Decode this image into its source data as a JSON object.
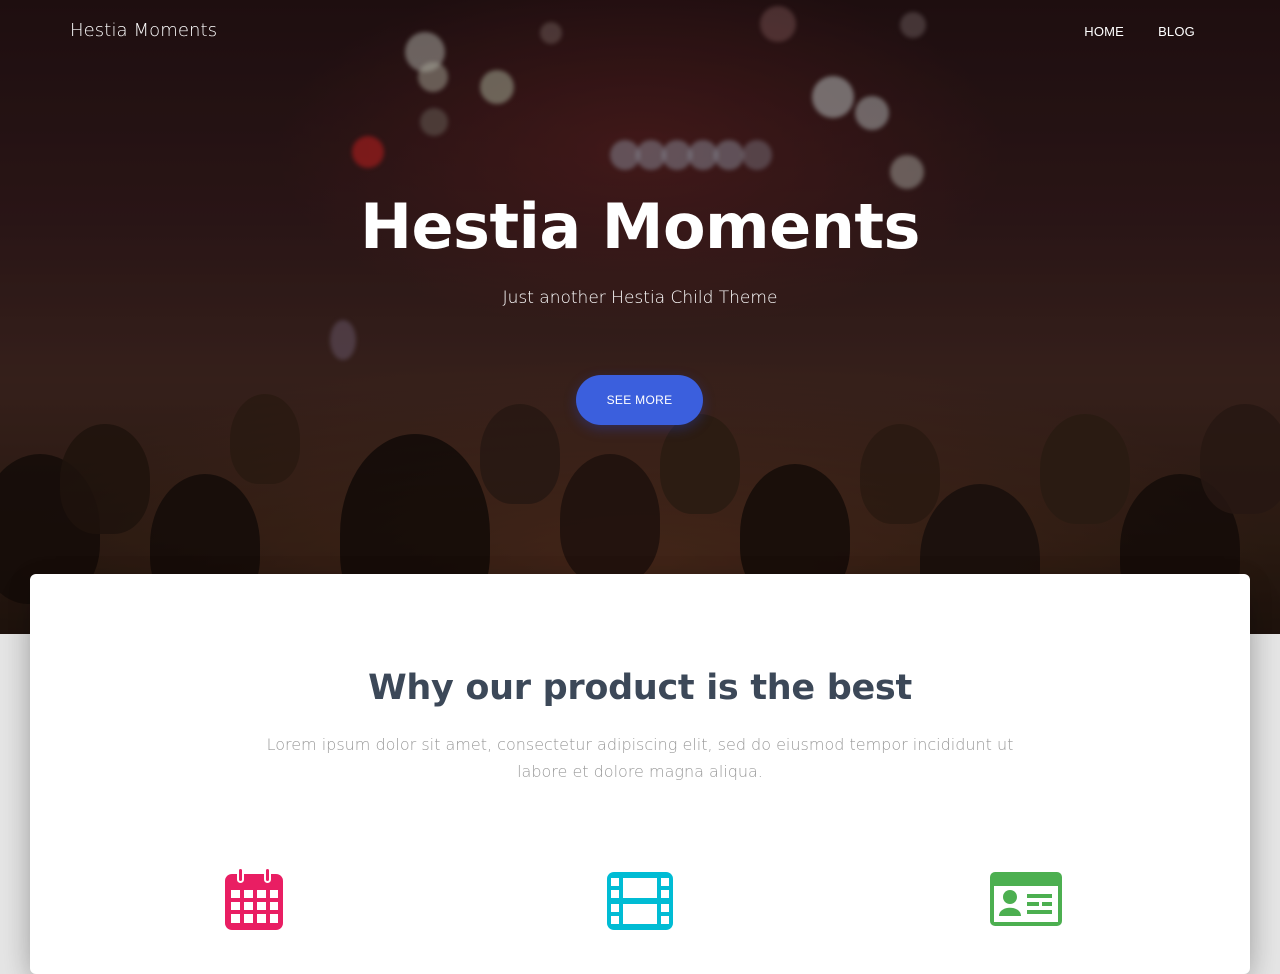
{
  "navbar": {
    "brand": "Hestia Moments",
    "links": [
      "HOME",
      "BLOG"
    ]
  },
  "hero": {
    "title": "Hestia Moments",
    "subtitle": "Just another Hestia Child Theme",
    "button_label": "SEE MORE"
  },
  "features": {
    "title": "Why our product is the best",
    "description": "Lorem ipsum dolor sit amet, consectetur adipiscing elit, sed do eiusmod tempor incididunt ut labore et dolore magna aliqua.",
    "icons": [
      {
        "name": "calendar-icon",
        "color": "#e91e63"
      },
      {
        "name": "film-icon",
        "color": "#00bcd4"
      },
      {
        "name": "id-card-icon",
        "color": "#4caf50"
      }
    ]
  },
  "colors": {
    "accent": "#3b5fdd",
    "heading": "#3c4858",
    "muted": "#999999"
  }
}
